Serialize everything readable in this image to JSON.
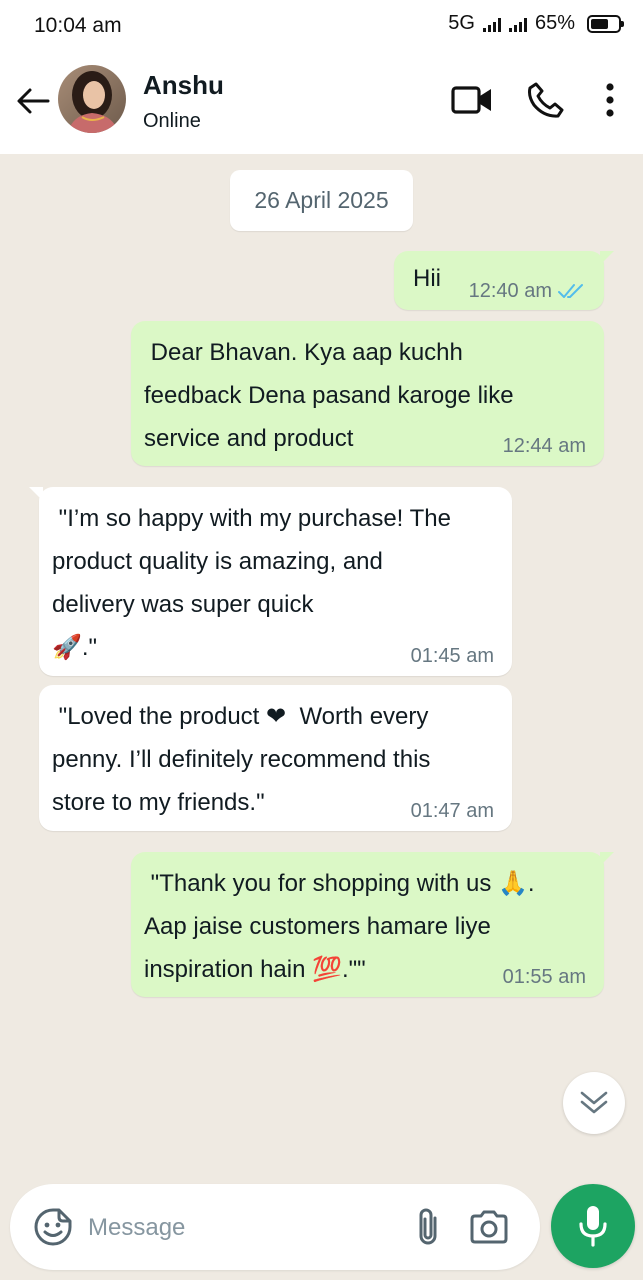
{
  "status_bar": {
    "time": "10:04 am",
    "network": "5G",
    "battery": "65%",
    "battery_level": 0.65
  },
  "header": {
    "back_icon": "back-arrow-icon",
    "contact_name": "Anshu",
    "contact_status": "Online",
    "video_call_icon": "video-camera-icon",
    "voice_call_icon": "phone-icon",
    "menu_icon": "more-vertical-icon"
  },
  "chat": {
    "date_chip": "26 April 2025",
    "messages": [
      {
        "direction": "out",
        "text": "Hii",
        "time": "12:40 am",
        "read": true
      },
      {
        "direction": "out",
        "text": " Dear Bhavan. Kya aap kuchh\nfeedback Dena pasand karoge like\nservice and product",
        "time": "12:44 am"
      },
      {
        "direction": "in",
        "text": " \"I’m so happy with my purchase! The\nproduct quality is amazing, and\ndelivery was super quick\n🚀.\"",
        "time": "01:45 am"
      },
      {
        "direction": "in",
        "text": " \"Loved the product ❤  Worth every\npenny. I’ll definitely recommend this\nstore to my friends.\"",
        "time": "01:47 am"
      },
      {
        "direction": "out",
        "text": " \"Thank you for shopping with us 🙏.\nAap jaise customers hamare liye\ninspiration hain 💯.\"\"",
        "time": "01:55 am"
      }
    ]
  },
  "composer": {
    "placeholder": "Message",
    "emoji_icon": "sticker-icon",
    "attach_icon": "paperclip-icon",
    "camera_icon": "camera-icon",
    "mic_icon": "microphone-icon"
  },
  "colors": {
    "outgoing_bubble": "#dbf8c6",
    "incoming_bubble": "#ffffff",
    "chat_background": "#efeae2",
    "accent_green": "#1da462",
    "read_tick": "#53bdeb"
  }
}
